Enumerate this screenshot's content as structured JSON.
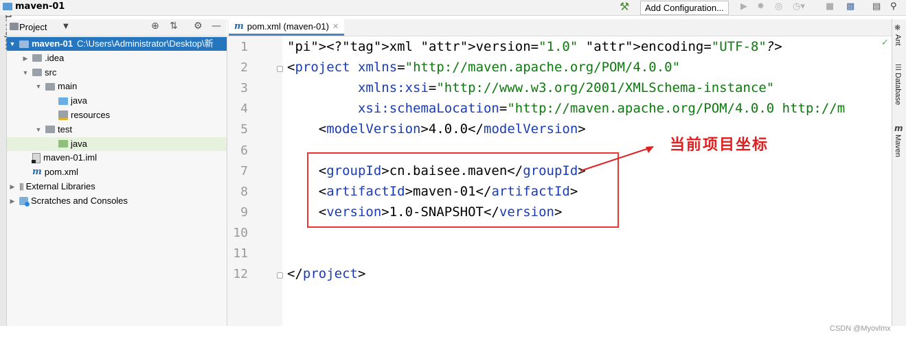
{
  "window": {
    "project_title": "maven-01"
  },
  "toolbar": {
    "add_config_label": "Add Configuration..."
  },
  "left_strip": {
    "label": "1: Project"
  },
  "project_panel": {
    "title": "Project",
    "tree": [
      {
        "label": "maven-01",
        "path": "C:\\Users\\Administrator\\Desktop\\新",
        "indent": 0,
        "arrow": "▼",
        "icon": "module-folder-icon",
        "selected": true
      },
      {
        "label": ".idea",
        "indent": 1,
        "arrow": "▶",
        "icon": "folder-icon"
      },
      {
        "label": "src",
        "indent": 1,
        "arrow": "▼",
        "icon": "folder-icon"
      },
      {
        "label": "main",
        "indent": 2,
        "arrow": "▼",
        "icon": "folder-icon"
      },
      {
        "label": "java",
        "indent": 3,
        "arrow": "",
        "icon": "source-folder-icon"
      },
      {
        "label": "resources",
        "indent": 3,
        "arrow": "",
        "icon": "resources-folder-icon"
      },
      {
        "label": "test",
        "indent": 2,
        "arrow": "▼",
        "icon": "folder-icon"
      },
      {
        "label": "java",
        "indent": 3,
        "arrow": "",
        "icon": "test-folder-icon",
        "highlighted": true
      },
      {
        "label": "maven-01.iml",
        "indent": 1,
        "arrow": "",
        "icon": "iml-file-icon"
      },
      {
        "label": "pom.xml",
        "indent": 1,
        "arrow": "",
        "icon": "maven-file-icon"
      },
      {
        "label": "External Libraries",
        "indent": 0,
        "arrow": "▶",
        "icon": "libraries-icon"
      },
      {
        "label": "Scratches and Consoles",
        "indent": 0,
        "arrow": "▶",
        "icon": "scratches-icon"
      }
    ]
  },
  "editor": {
    "tab_label": "pom.xml (maven-01)",
    "line_numbers": [
      "1",
      "2",
      "3",
      "4",
      "5",
      "6",
      "7",
      "8",
      "9",
      "10",
      "11",
      "12"
    ],
    "lines": [
      "<?xml version=\"1.0\" encoding=\"UTF-8\"?>",
      "<project xmlns=\"http://maven.apache.org/POM/4.0.0\"",
      "         xmlns:xsi=\"http://www.w3.org/2001/XMLSchema-instance\"",
      "         xsi:schemaLocation=\"http://maven.apache.org/POM/4.0.0 http://m",
      "    <modelVersion>4.0.0</modelVersion>",
      "",
      "    <groupId>cn.baisee.maven</groupId>",
      "    <artifactId>maven-01</artifactId>",
      "    <version>1.0-SNAPSHOT</version>",
      "",
      "",
      "</project>"
    ]
  },
  "annotation": {
    "text": "当前项目坐标",
    "color": "#e02020"
  },
  "right_strip": {
    "labels": [
      "Ant",
      "Database",
      "Maven"
    ]
  },
  "watermark": "CSDN @Myovlmx"
}
